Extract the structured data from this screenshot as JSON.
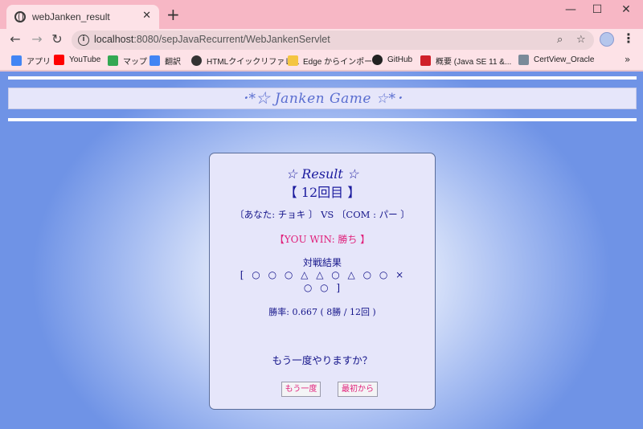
{
  "browser": {
    "tab_title": "webJanken_result",
    "tab_close": "✕",
    "new_tab": "+",
    "url_host": "localhost",
    "url_path": ":8080/sepJavaRecurrent/WebJankenServlet",
    "window_minimize": "—",
    "window_maximize": "☐",
    "window_close": "✕",
    "back": "←",
    "forward": "→",
    "reload": "↻",
    "zoom_icon": "⌕",
    "star_icon": "☆",
    "menu": "⋮",
    "bookmarks_more": "»",
    "bookmarks": [
      {
        "label": "アプリ",
        "icon": "apps-grid-icon",
        "color": "#4285f4"
      },
      {
        "label": "YouTube",
        "icon": "youtube-icon",
        "color": "#ff0000"
      },
      {
        "label": "マップ",
        "icon": "maps-icon",
        "color": "#34a853"
      },
      {
        "label": "翻訳",
        "icon": "translate-icon",
        "color": "#4285f4"
      },
      {
        "label": "HTMLクイックリファレ...",
        "icon": "globe-icon",
        "color": "#333333"
      },
      {
        "label": "Edge からインポート",
        "icon": "folder-icon",
        "color": "#f4c542"
      },
      {
        "label": "GitHub",
        "icon": "github-icon",
        "color": "#222222"
      },
      {
        "label": "概要 (Java SE 11 &...",
        "icon": "oracle-icon",
        "color": "#d0202a"
      },
      {
        "label": "CertView_Oracle",
        "icon": "certview-icon",
        "color": "#7a8a99"
      }
    ]
  },
  "game": {
    "banner": "･*☆ Janken Game ☆*･",
    "result_title": "☆ Result ☆",
    "round": "【 12回目 】",
    "versus": "〔あなた: チョキ 〕 VS 〔COM : パー 〕",
    "win_message": "【YOU WIN: 勝ち 】",
    "history_label": "対戦結果",
    "history": "[ ○ ○ ○ △ △ ○ △ ○ ○ × ○ ○ ]",
    "win_rate": "勝率: 0.667 ( 8勝 / 12回 )",
    "again_question": "もう一度やりますか？",
    "again_button": "もう一度",
    "restart_button": "最初から"
  },
  "colors": {
    "accent_pink": "#e0207a",
    "text_navy": "#15158a",
    "panel_bg": "#e6e6fa",
    "page_blue": "#6f93e6"
  }
}
